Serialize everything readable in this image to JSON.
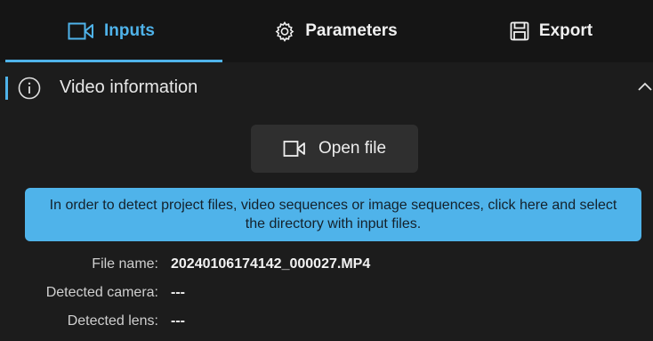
{
  "tabs": [
    {
      "label": "Inputs",
      "icon": "video-camera-icon",
      "active": true
    },
    {
      "label": "Parameters",
      "icon": "gear-icon",
      "active": false
    },
    {
      "label": "Export",
      "icon": "save-icon",
      "active": false
    }
  ],
  "section": {
    "title": "Video information",
    "icon": "info-icon",
    "collapse_icon": "chevron-up-icon"
  },
  "open_file_button": {
    "label": "Open file",
    "icon": "video-camera-icon"
  },
  "banner": {
    "text": "In order to detect project files, video sequences or image sequences, click here and select the directory with input files."
  },
  "details": {
    "file_name_label": "File name:",
    "file_name_value": "20240106174142_000027.MP4",
    "camera_label": "Detected camera:",
    "camera_value": "---",
    "lens_label": "Detected lens:",
    "lens_value": "---"
  },
  "colors": {
    "accent": "#4fb3ea",
    "background": "#1c1c1c",
    "tabbar": "#151515",
    "button": "#2f2f2f"
  }
}
